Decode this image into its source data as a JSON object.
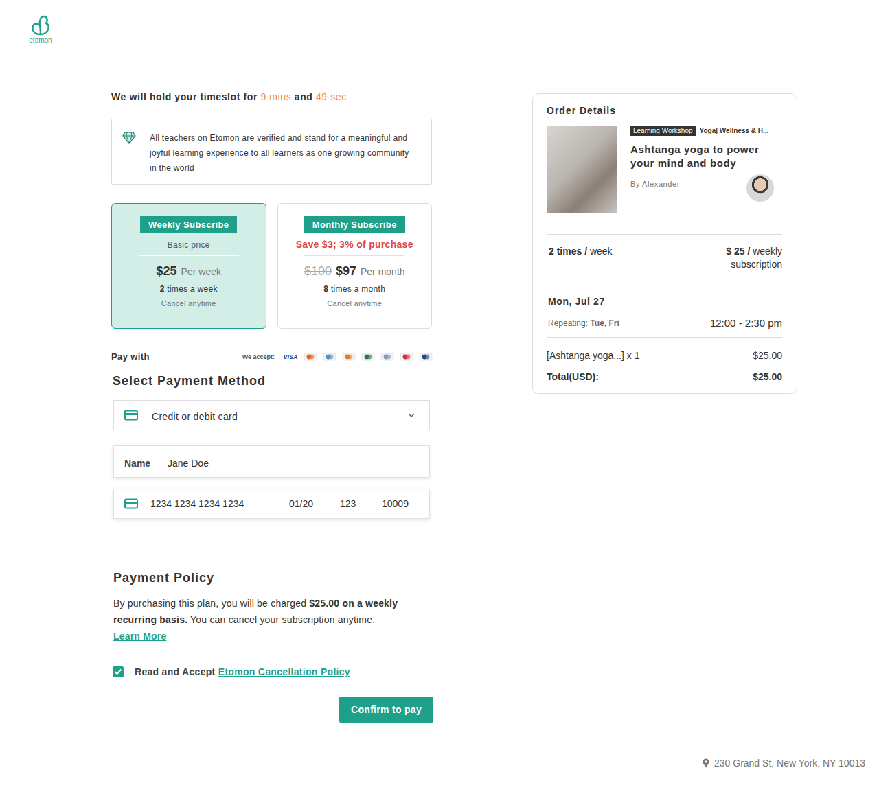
{
  "logo": {
    "name": "etomon"
  },
  "timer": {
    "prefix": "We will hold your timeslot for",
    "minutes": "9 mins",
    "joiner": "and",
    "seconds": "49 sec"
  },
  "notice": {
    "text": "All teachers on Etomon are verified and stand for a meaningful and joyful learning experience to all learners as one growing community in the world"
  },
  "plans": [
    {
      "title": "Weekly Subscribe",
      "subtitle": "Basic price",
      "kind": "basic",
      "price": "$25",
      "unit": "Per week",
      "count": "2",
      "count_text": "times a week",
      "note": "Cancel anytime",
      "selected": true
    },
    {
      "title": "Monthly Subscribe",
      "subtitle": "Save $3; 3% of purchase",
      "kind": "discount",
      "old_price": "$100",
      "price": "$97",
      "unit": "Per month",
      "count": "8",
      "count_text": "times a month",
      "note": "Cancel anytime",
      "selected": false
    }
  ],
  "payment": {
    "pay_with": "Pay with",
    "we_accept": "We accept:",
    "cards": [
      {
        "label": "VISA",
        "color": "#1a3e8c"
      },
      {
        "color": "#eb5f1f"
      },
      {
        "color": "#4a8fd1"
      },
      {
        "color": "#e07b2a"
      },
      {
        "color": "#2a7a3b"
      },
      {
        "color": "#7f9bb8"
      },
      {
        "color": "#d6303a"
      },
      {
        "color": "#1f4a8c"
      }
    ],
    "section_title": "Select Payment Method",
    "method": {
      "value": "Credit or debit card",
      "expanded": false
    },
    "name": {
      "label": "Name",
      "value": "Jane Doe"
    },
    "card": {
      "number": "1234 1234 1234 1234",
      "expiry": "01/20",
      "cvc": "123",
      "zip": "10009"
    }
  },
  "policy": {
    "title": "Payment Policy",
    "text_before": "By purchasing this plan, you will be charged",
    "text_bold": "$25.00 on a weekly recurring basis.",
    "text_after": "You can cancel your subscription anytime.",
    "link": "Learn More"
  },
  "agreement": {
    "checked": true,
    "text": "Read and Accept",
    "link": "Etomon Cancellation Policy"
  },
  "confirm_button": "Confirm to pay",
  "order": {
    "title": "Order Details",
    "badge": "Learning Workshop",
    "categories": "Yoga| Wellness & H...",
    "course_title": "Ashtanga yoga to power your mind and body",
    "author": "By Alexander",
    "frequency_bold": "2 times /",
    "frequency_rest": "week",
    "price_bold": "$ 25 /",
    "price_rest": "weekly subscription",
    "date": "Mon, Jul 27",
    "repeating_label": "Repeating:",
    "repeating_days": "Tue, Fri",
    "time": "12:00 - 2:30 pm",
    "line_item": "[Ashtanga yoga...] x 1",
    "line_price": "$25.00",
    "total_label": "Total(USD):",
    "total": "$25.00"
  },
  "footer": {
    "address": "230 Grand St, New York, NY 10013"
  }
}
